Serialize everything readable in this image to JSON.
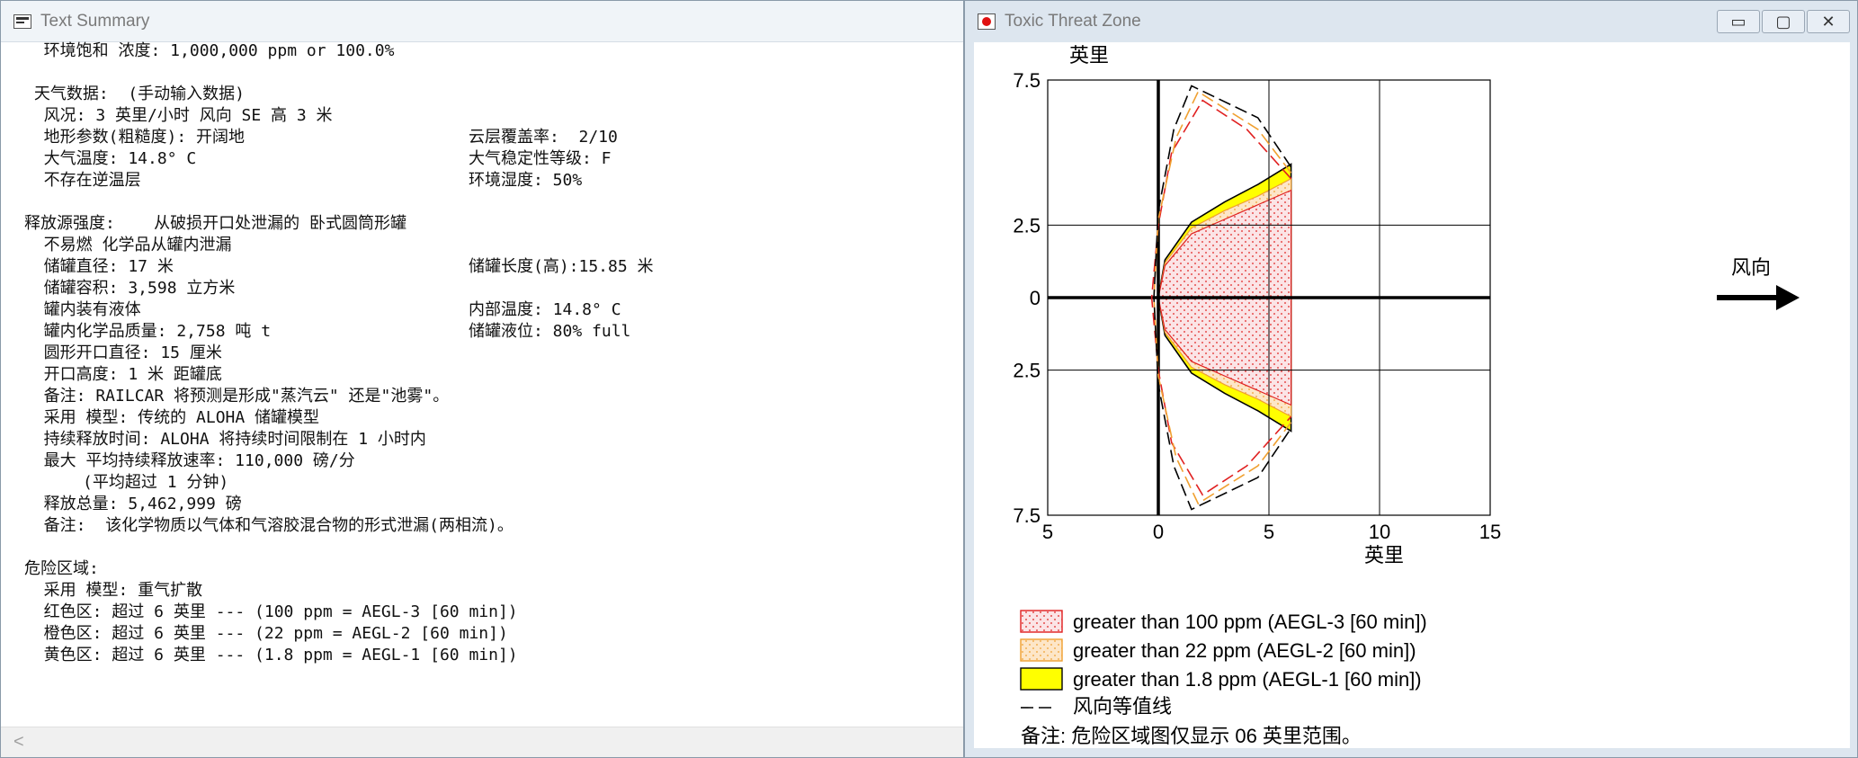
{
  "text_window": {
    "title": "Text Summary",
    "lines": [
      {
        "a": "  环境饱和 浓度: 1,000,000 ppm or 100.0%",
        "b": ""
      },
      {
        "a": "",
        "b": ""
      },
      {
        "a": " 天气数据:  (手动输入数据)",
        "b": ""
      },
      {
        "a": "  风况: 3 英里/小时 风向 SE 高 3 米",
        "b": ""
      },
      {
        "a": "  地形参数(粗糙度): 开阔地",
        "b": "云层覆盖率:  2/10"
      },
      {
        "a": "  大气温度: 14.8° C",
        "b": "大气稳定性等级: F"
      },
      {
        "a": "  不存在逆温层",
        "b": "环境湿度: 50%"
      },
      {
        "a": "",
        "b": ""
      },
      {
        "a": "释放源强度:    从破损开口处泄漏的 卧式圆筒形罐",
        "b": ""
      },
      {
        "a": "  不易燃 化学品从罐内泄漏",
        "b": ""
      },
      {
        "a": "  储罐直径: 17 米",
        "b": "储罐长度(高):15.85 米"
      },
      {
        "a": "  储罐容积: 3,598 立方米",
        "b": ""
      },
      {
        "a": "  罐内装有液体",
        "b": "内部温度: 14.8° C"
      },
      {
        "a": "  罐内化学品质量: 2,758 吨 t",
        "b": "储罐液位: 80% full"
      },
      {
        "a": "  圆形开口直径: 15 厘米",
        "b": ""
      },
      {
        "a": "  开口高度: 1 米 距罐底",
        "b": ""
      },
      {
        "a": "  备注: RAILCAR 将预测是形成\"蒸汽云\" 还是\"池雾\"。",
        "b": ""
      },
      {
        "a": "  采用 模型: 传统的 ALOHA 储罐模型",
        "b": ""
      },
      {
        "a": "  持续释放时间: ALOHA 将持续时间限制在 1 小时内",
        "b": ""
      },
      {
        "a": "  最大 平均持续释放速率: 110,000 磅/分",
        "b": ""
      },
      {
        "a": "      (平均超过 1 分钟)",
        "b": ""
      },
      {
        "a": "  释放总量: 5,462,999 磅",
        "b": ""
      },
      {
        "a": "  备注:  该化学物质以气体和气溶胶混合物的形式泄漏(两相流)。",
        "b": ""
      },
      {
        "a": "",
        "b": ""
      },
      {
        "a": "危险区域:",
        "b": ""
      },
      {
        "a": "  采用 模型: 重气扩散",
        "b": ""
      },
      {
        "a": "  红色区: 超过 6 英里 --- (100 ppm = AEGL-3 [60 min])",
        "b": ""
      },
      {
        "a": "  橙色区: 超过 6 英里 --- (22 ppm = AEGL-2 [60 min])",
        "b": ""
      },
      {
        "a": "  黄色区: 超过 6 英里 --- (1.8 ppm = AEGL-1 [60 min])",
        "b": ""
      }
    ],
    "scroll_left_arrow": "<"
  },
  "threat_window": {
    "title": "Toxic Threat Zone",
    "buttons": {
      "minimize": "▭",
      "maximize": "▢",
      "close": "✕"
    },
    "colors": {
      "red": "#e02020",
      "orange": "#f0a030",
      "yellow": "#ffff00",
      "pink_fill": "#fbe4e6"
    },
    "wind_label": "风向",
    "legend": [
      {
        "swatch": "red-dotted",
        "label": "greater than 100 ppm (AEGL-3 [60 min])"
      },
      {
        "swatch": "orange-dotted",
        "label": "greater than 22 ppm (AEGL-2 [60 min])"
      },
      {
        "swatch": "yellow-solid",
        "label": "greater than 1.8 ppm (AEGL-1 [60 min])"
      },
      {
        "swatch": "dashed-line",
        "label": "风向等值线"
      }
    ],
    "note": "备注: 危险区域图仅显示 06 英里范围。"
  },
  "chart_data": {
    "type": "area",
    "xlabel": "英里",
    "ylabel": "英里",
    "xlim": [
      -5,
      15
    ],
    "ylim": [
      -7.5,
      7.5
    ],
    "xticks": [
      "5",
      "0",
      "5",
      "10",
      "15"
    ],
    "yticks": [
      "7.5",
      "2.5",
      "0",
      "2.5",
      "7.5"
    ],
    "grid": true,
    "legend_position": "bottom",
    "zones": [
      {
        "name": "AEGL-3",
        "color": "#e02020",
        "fill": "dotted-pink",
        "downwind_max": 6,
        "upper_edge": [
          [
            0,
            0
          ],
          [
            0.3,
            1.1
          ],
          [
            1.5,
            2.2
          ],
          [
            3,
            2.7
          ],
          [
            4.5,
            3.2
          ],
          [
            6,
            3.7
          ]
        ]
      },
      {
        "name": "AEGL-2",
        "color": "#f0a030",
        "fill": "dotted-orange",
        "downwind_max": 6,
        "upper_edge": [
          [
            0,
            0
          ],
          [
            0.3,
            1.2
          ],
          [
            1.5,
            2.4
          ],
          [
            3,
            3
          ],
          [
            4.5,
            3.5
          ],
          [
            6,
            4.1
          ]
        ]
      },
      {
        "name": "AEGL-1",
        "color": "#ffff00",
        "fill": "solid",
        "downwind_max": 6,
        "upper_edge": [
          [
            0,
            0
          ],
          [
            0.3,
            1.3
          ],
          [
            1.5,
            2.6
          ],
          [
            3,
            3.3
          ],
          [
            4.5,
            3.9
          ],
          [
            6,
            4.6
          ]
        ]
      }
    ],
    "confidence_lines": [
      {
        "name": "red",
        "color": "#e02020",
        "points": [
          [
            -0.3,
            0
          ],
          [
            0,
            2.5
          ],
          [
            0.6,
            5
          ],
          [
            2,
            6.8
          ],
          [
            4,
            5.8
          ],
          [
            6,
            4.1
          ]
        ]
      },
      {
        "name": "orange",
        "color": "#f0a030",
        "points": [
          [
            -0.2,
            0
          ],
          [
            0,
            2.7
          ],
          [
            0.8,
            5.5
          ],
          [
            1.8,
            7.1
          ],
          [
            4.5,
            5.8
          ],
          [
            6,
            4.3
          ]
        ]
      },
      {
        "name": "black",
        "color": "#000000",
        "points": [
          [
            -0.2,
            0
          ],
          [
            0,
            3
          ],
          [
            0.7,
            5.8
          ],
          [
            1.5,
            7.3
          ],
          [
            4.5,
            6.2
          ],
          [
            6,
            4.5
          ]
        ]
      }
    ]
  }
}
